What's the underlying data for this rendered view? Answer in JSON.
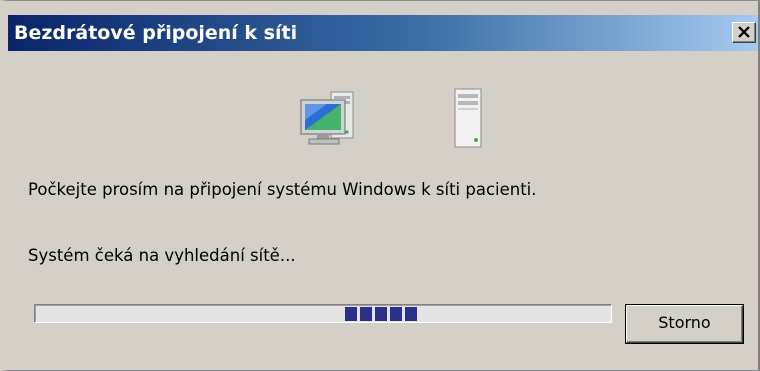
{
  "window": {
    "title": "Bezdrátové připojení k síti",
    "close_label": "×"
  },
  "icons": {
    "computer": "computer-icon",
    "server": "server-icon"
  },
  "body": {
    "wait_message": "Počkejte prosím na připojení systému Windows k síti pacienti.",
    "status_message": "Systém čeká na vyhledání sítě..."
  },
  "progress": {
    "mode": "marquee",
    "segments": 5,
    "color": "#2a2f8a"
  },
  "buttons": {
    "cancel_label": "Storno"
  },
  "colors": {
    "title_gradient_start": "#0a246a",
    "title_gradient_end": "#a6caf0",
    "face": "#d4d0c8"
  }
}
